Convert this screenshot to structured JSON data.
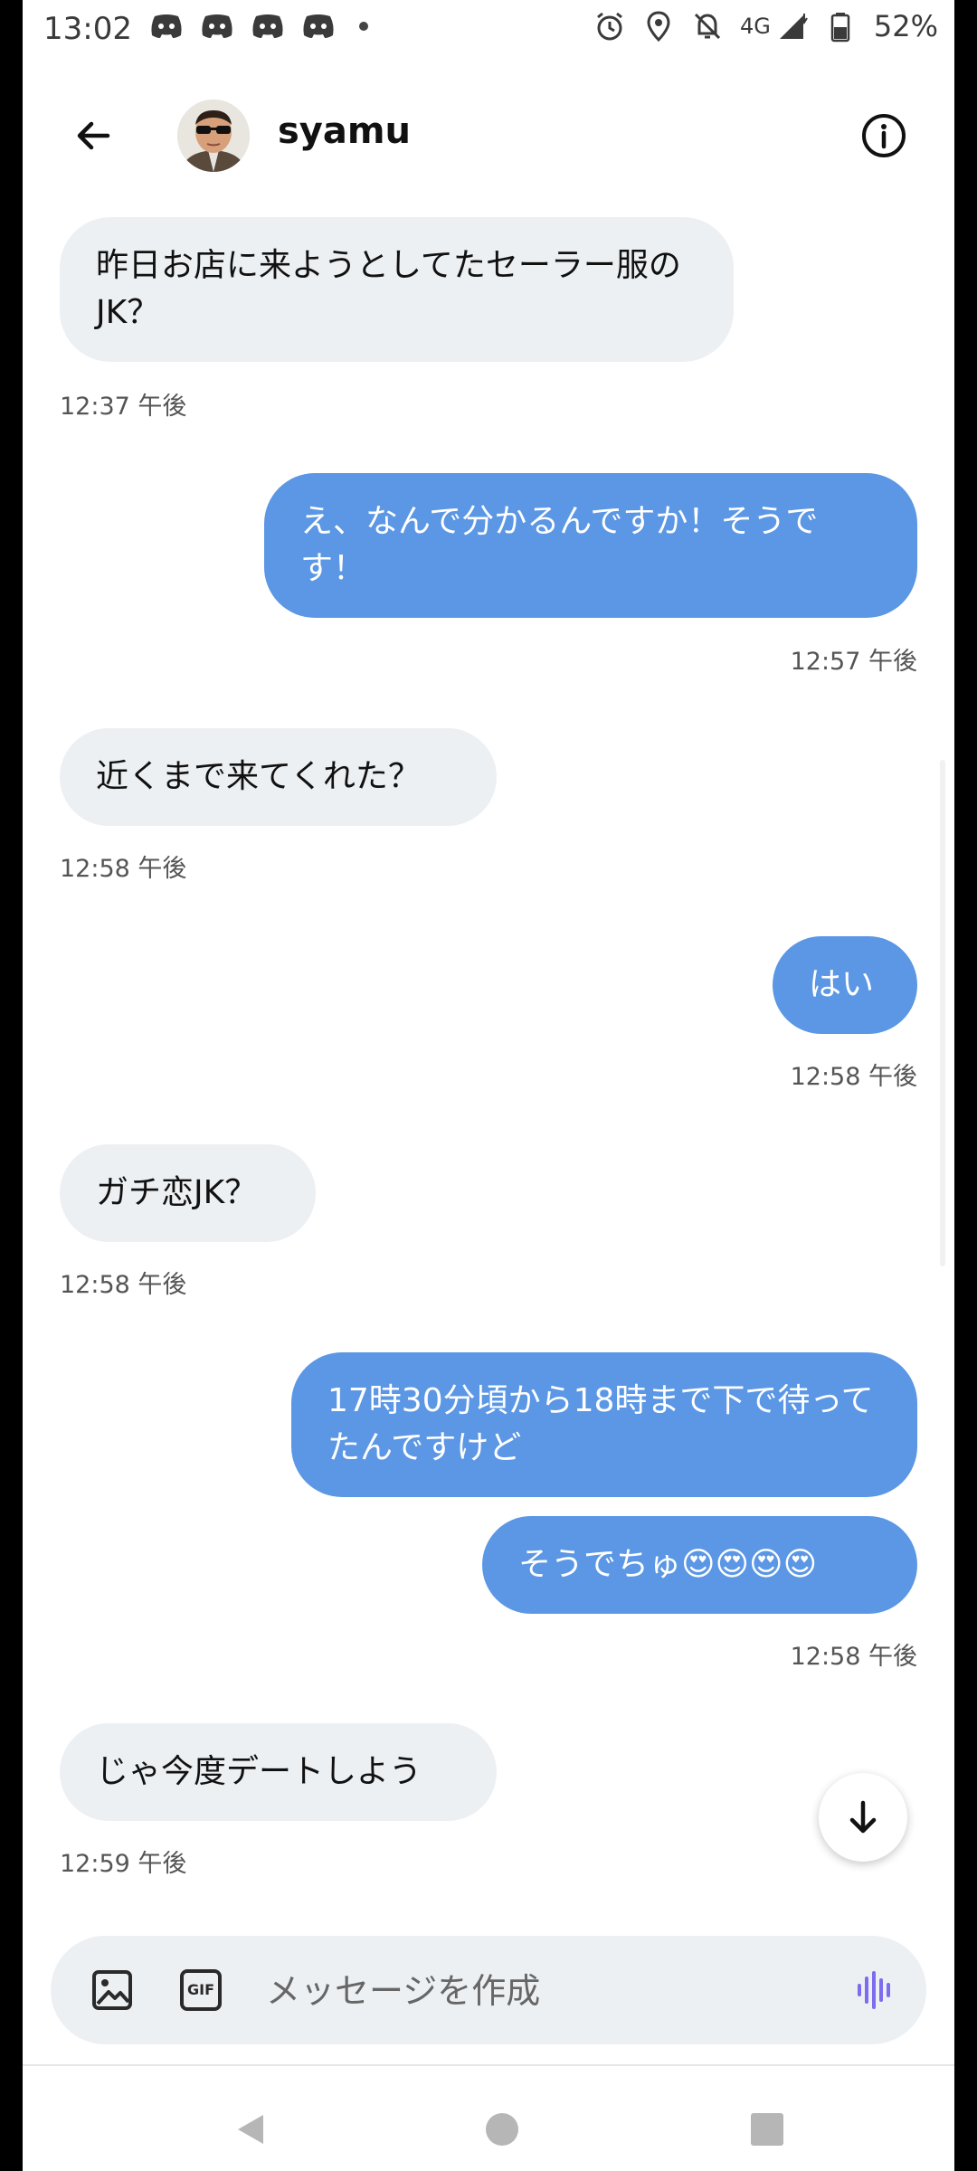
{
  "status_bar": {
    "time": "13:02",
    "network": "4G",
    "battery": "52%",
    "notification_icons": [
      "discord-icon",
      "discord-icon",
      "discord-icon",
      "discord-icon"
    ],
    "right_icons": [
      "alarm-icon",
      "location-icon",
      "notifications-off-icon",
      "signal-icon",
      "battery-icon"
    ]
  },
  "header": {
    "contact_name": "syamu",
    "back_icon": "arrow-left-icon",
    "info_icon": "info-icon"
  },
  "messages": [
    {
      "direction": "in",
      "text": "昨日お店に来ようとしてたセーラー服のJK？",
      "time": "12:37 午後"
    },
    {
      "direction": "out",
      "text": "え、なんで分かるんですか！そうです！",
      "time": "12:57 午後"
    },
    {
      "direction": "in",
      "text": "近くまで来てくれた？",
      "time": "12:58 午後"
    },
    {
      "direction": "out",
      "text": "はい",
      "time": "12:58 午後"
    },
    {
      "direction": "in",
      "text": "ガチ恋JK？",
      "time": "12:58 午後"
    },
    {
      "direction": "out",
      "text": "17時30分頃から18時まで下で待ってたんですけど",
      "time": ""
    },
    {
      "direction": "out",
      "text": "そうでちゅ😍😍😍😍",
      "time": "12:58 午後"
    },
    {
      "direction": "in",
      "text": "じゃ今度デートしよう",
      "time": "12:59 午後"
    }
  ],
  "composer": {
    "placeholder": "メッセージを作成",
    "image_icon": "image-icon",
    "gif_label": "GIF",
    "voice_icon": "voice-wave-icon"
  },
  "colors": {
    "outgoing_bubble": "#5b97e4",
    "incoming_bubble": "#edf0f3",
    "voice_accent": "#7b6cf0"
  },
  "nav": {
    "icons": [
      "back-triangle-icon",
      "home-circle-icon",
      "recents-square-icon"
    ]
  }
}
